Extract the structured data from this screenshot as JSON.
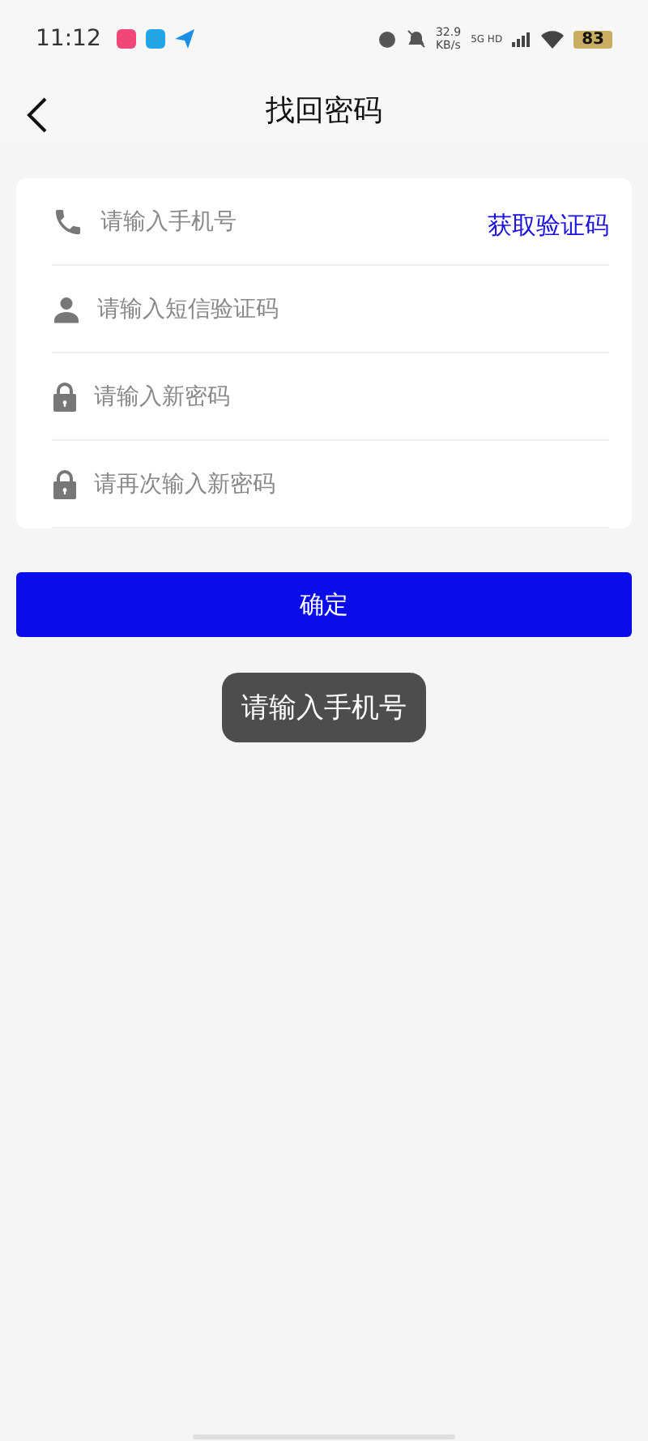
{
  "status_bar": {
    "time": "11:12",
    "speed": "32.9",
    "speed_unit": "KB/s",
    "network": "5G HD",
    "battery": "83"
  },
  "header": {
    "title": "找回密码"
  },
  "fields": [
    {
      "kind": "phone",
      "placeholder": "请输入手机号",
      "action": "获取验证码"
    },
    {
      "kind": "code",
      "placeholder": "请输入短信验证码"
    },
    {
      "kind": "password",
      "placeholder": "请输入新密码"
    },
    {
      "kind": "password",
      "placeholder": "请再次输入新密码"
    }
  ],
  "submit": "确定",
  "toast": "请输入手机号"
}
